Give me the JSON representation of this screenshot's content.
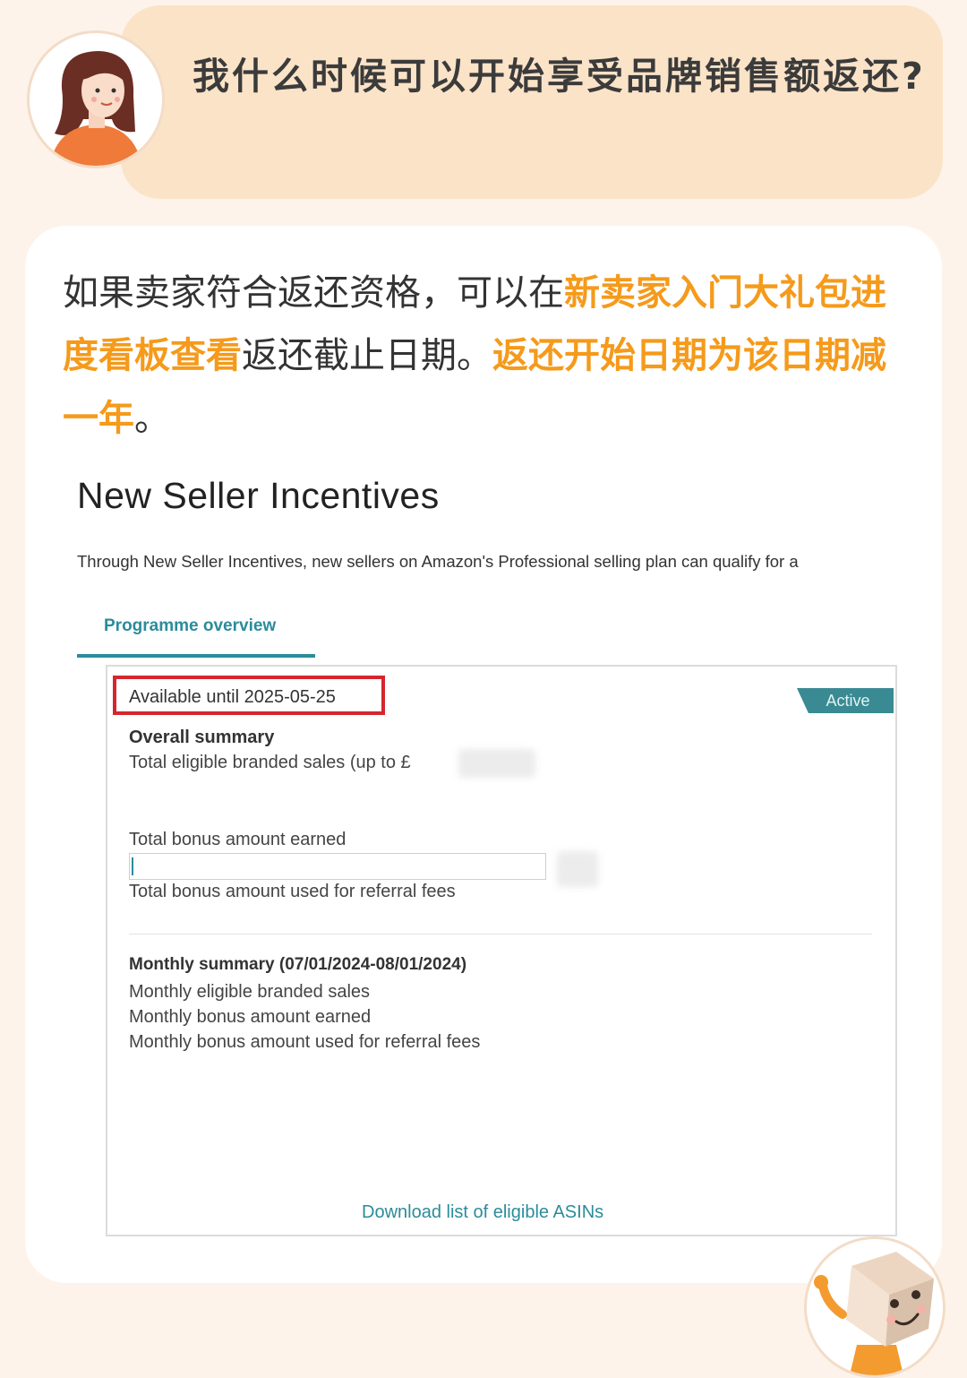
{
  "question": {
    "text": "我什么时候可以开始享受品牌销售额返还?"
  },
  "answer": {
    "part1": "如果卖家符合返还资格，可以在",
    "part2_highlight": "新卖家入门大礼包进度看板查看",
    "part3": "返还截止日期。",
    "part4_highlight": "返还开始日期为该日期减一年",
    "part5": "。"
  },
  "screenshot": {
    "title": "New Seller Incentives",
    "description": "Through New Seller Incentives, new sellers on Amazon's Professional selling plan can qualify for a",
    "tab_label": "Programme overview",
    "available_until": "Available until 2025-05-25",
    "status_badge": "Active",
    "overall_summary_heading": "Overall summary",
    "total_eligible_sales": "Total eligible branded sales (up to £",
    "total_bonus_earned": "Total bonus amount earned",
    "total_bonus_used": "Total bonus amount used for referral fees",
    "monthly_summary_heading": "Monthly summary (07/01/2024-08/01/2024)",
    "monthly_eligible_sales": "Monthly eligible branded sales",
    "monthly_bonus_earned": "Monthly bonus amount earned",
    "monthly_bonus_used": "Monthly bonus amount used for referral fees",
    "download_link": "Download list of eligible ASINs"
  },
  "icons": {
    "avatar": "woman-avatar-icon",
    "mascot": "box-mascot-icon"
  },
  "colors": {
    "page_background": "#fdf3ea",
    "question_bubble": "#fbe3c8",
    "highlight": "#f59a1b",
    "teal": "#2b8c9a",
    "red_box": "#d5262e"
  }
}
